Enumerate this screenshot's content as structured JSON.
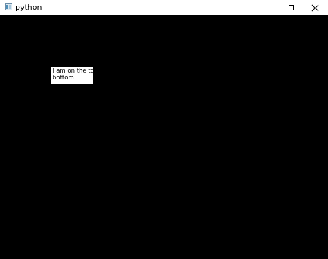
{
  "window": {
    "title": "python",
    "icon": "python-app-icon",
    "controls": {
      "minimize": "minimize-icon",
      "maximize": "maximize-icon",
      "close": "close-icon"
    }
  },
  "canvas": {
    "background": "#000000",
    "label": {
      "line1": "I am on the top",
      "line2": "bottom"
    }
  }
}
